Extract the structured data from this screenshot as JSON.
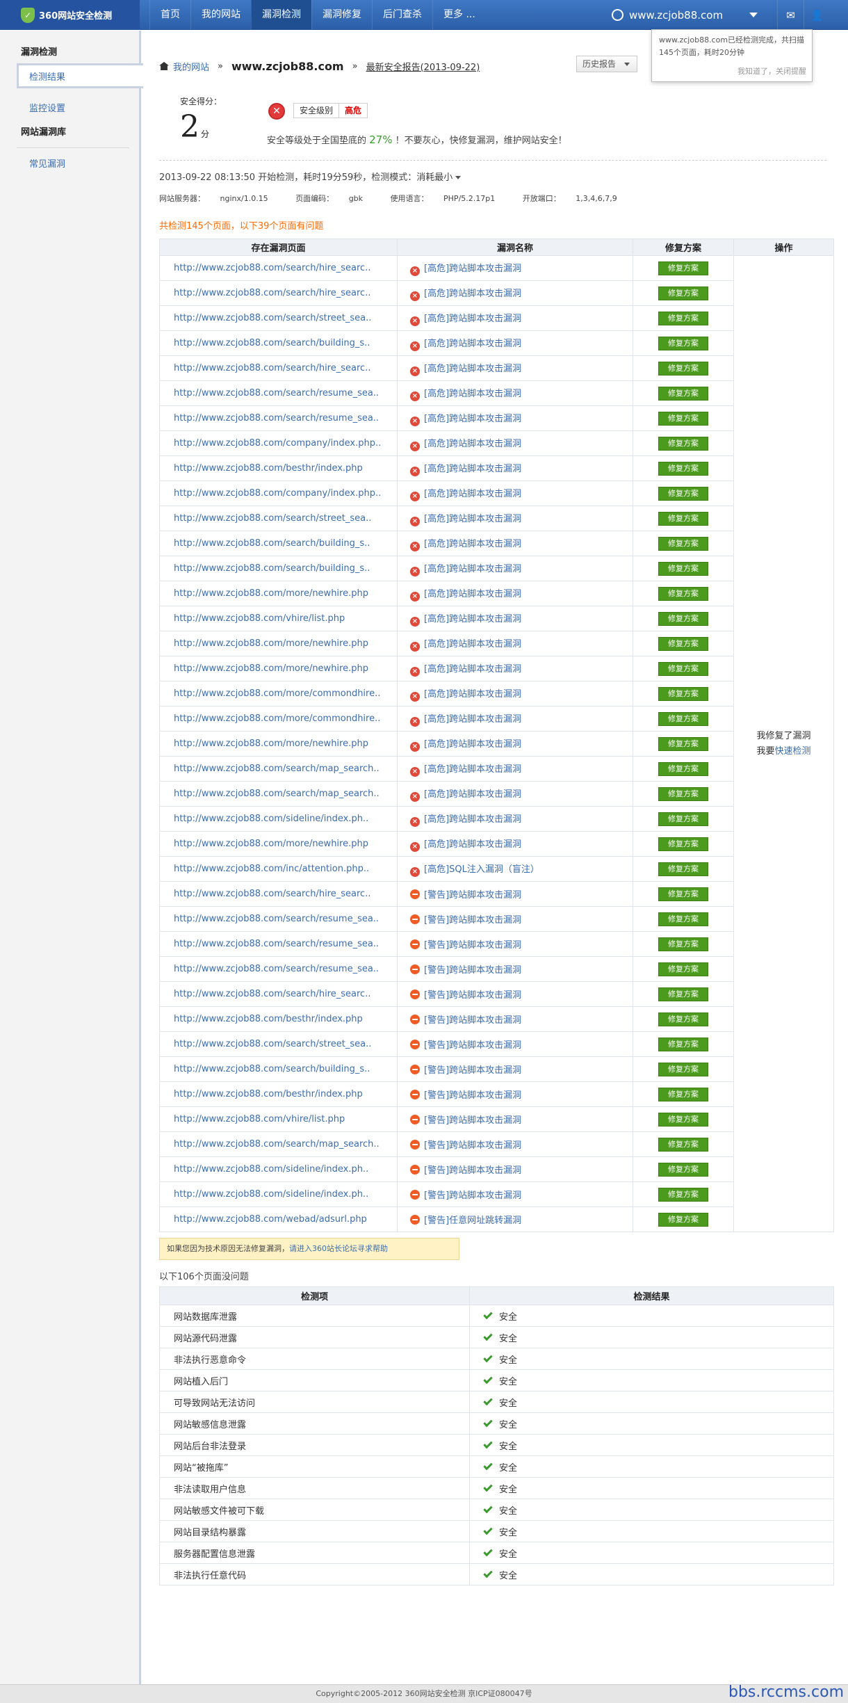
{
  "header": {
    "logo_text": "360网站安全检测",
    "nav": [
      "首页",
      "我的网站",
      "漏洞检测",
      "漏洞修复",
      "后门查杀",
      "更多 ..."
    ],
    "active_nav": 2,
    "site_domain": "www.zcjob88.com",
    "mail_icon": "mail-icon",
    "user_icon": "user-icon"
  },
  "popup": {
    "message": "www.zcjob88.com已经检测完成，共扫描145个页面，耗时20分钟",
    "dismiss": "我知道了，关闭提醒"
  },
  "sidebar": {
    "section1": "漏洞检测",
    "items1": [
      "检测结果",
      "监控设置"
    ],
    "section2": "网站漏洞库",
    "items2": [
      "常见漏洞"
    ]
  },
  "breadcrumb": {
    "home": "我的网站",
    "domain": "www.zcjob88.com",
    "latest_report": "最新安全报告(2013-09-22)",
    "history_button": "历史报告"
  },
  "score": {
    "label": "安全得分：",
    "value": "2",
    "unit": "分",
    "level_label": "安全级别",
    "level_value": "高危",
    "ad_prefix": "安全等级处于全国垫底的",
    "ad_percent": "27%",
    "ad_suffix": "！不要灰心，快修复漏洞，维护网站安全！"
  },
  "scan": {
    "timeline": "2013-09-22 08:13:50 开始检测，耗时19分59秒，检测模式：消耗最小",
    "server_label": "网站服务器：",
    "server": "nginx/1.0.15",
    "encoding_label": "页面编码：",
    "encoding": "gbk",
    "language_label": "使用语言：",
    "language": "PHP/5.2.17p1",
    "ports_label": "开放端口：",
    "ports": "1,3,4,6,7,9",
    "summary": "共检测145个页面，以下39个页面有问题"
  },
  "vuln_table": {
    "headers": [
      "存在漏洞页面",
      "漏洞名称",
      "修复方案",
      "操作"
    ],
    "fix_label": "修复方案",
    "op_line1": "我修复了漏洞",
    "op_line2_prefix": "我要",
    "op_line2_link": "快速检测",
    "rows": [
      {
        "url": "http://www.zcjob88.com/search/hire_searc..",
        "severity": "high",
        "name": "[高危]跨站脚本攻击漏洞"
      },
      {
        "url": "http://www.zcjob88.com/search/hire_searc..",
        "severity": "high",
        "name": "[高危]跨站脚本攻击漏洞"
      },
      {
        "url": "http://www.zcjob88.com/search/street_sea..",
        "severity": "high",
        "name": "[高危]跨站脚本攻击漏洞"
      },
      {
        "url": "http://www.zcjob88.com/search/building_s..",
        "severity": "high",
        "name": "[高危]跨站脚本攻击漏洞"
      },
      {
        "url": "http://www.zcjob88.com/search/hire_searc..",
        "severity": "high",
        "name": "[高危]跨站脚本攻击漏洞"
      },
      {
        "url": "http://www.zcjob88.com/search/resume_sea..",
        "severity": "high",
        "name": "[高危]跨站脚本攻击漏洞"
      },
      {
        "url": "http://www.zcjob88.com/search/resume_sea..",
        "severity": "high",
        "name": "[高危]跨站脚本攻击漏洞"
      },
      {
        "url": "http://www.zcjob88.com/company/index.php..",
        "severity": "high",
        "name": "[高危]跨站脚本攻击漏洞"
      },
      {
        "url": "http://www.zcjob88.com/besthr/index.php",
        "severity": "high",
        "name": "[高危]跨站脚本攻击漏洞"
      },
      {
        "url": "http://www.zcjob88.com/company/index.php..",
        "severity": "high",
        "name": "[高危]跨站脚本攻击漏洞"
      },
      {
        "url": "http://www.zcjob88.com/search/street_sea..",
        "severity": "high",
        "name": "[高危]跨站脚本攻击漏洞"
      },
      {
        "url": "http://www.zcjob88.com/search/building_s..",
        "severity": "high",
        "name": "[高危]跨站脚本攻击漏洞"
      },
      {
        "url": "http://www.zcjob88.com/search/building_s..",
        "severity": "high",
        "name": "[高危]跨站脚本攻击漏洞"
      },
      {
        "url": "http://www.zcjob88.com/more/newhire.php",
        "severity": "high",
        "name": "[高危]跨站脚本攻击漏洞"
      },
      {
        "url": "http://www.zcjob88.com/vhire/list.php",
        "severity": "high",
        "name": "[高危]跨站脚本攻击漏洞"
      },
      {
        "url": "http://www.zcjob88.com/more/newhire.php",
        "severity": "high",
        "name": "[高危]跨站脚本攻击漏洞"
      },
      {
        "url": "http://www.zcjob88.com/more/newhire.php",
        "severity": "high",
        "name": "[高危]跨站脚本攻击漏洞"
      },
      {
        "url": "http://www.zcjob88.com/more/commondhire..",
        "severity": "high",
        "name": "[高危]跨站脚本攻击漏洞"
      },
      {
        "url": "http://www.zcjob88.com/more/commondhire..",
        "severity": "high",
        "name": "[高危]跨站脚本攻击漏洞"
      },
      {
        "url": "http://www.zcjob88.com/more/newhire.php",
        "severity": "high",
        "name": "[高危]跨站脚本攻击漏洞"
      },
      {
        "url": "http://www.zcjob88.com/search/map_search..",
        "severity": "high",
        "name": "[高危]跨站脚本攻击漏洞"
      },
      {
        "url": "http://www.zcjob88.com/search/map_search..",
        "severity": "high",
        "name": "[高危]跨站脚本攻击漏洞"
      },
      {
        "url": "http://www.zcjob88.com/sideline/index.ph..",
        "severity": "high",
        "name": "[高危]跨站脚本攻击漏洞"
      },
      {
        "url": "http://www.zcjob88.com/more/newhire.php",
        "severity": "high",
        "name": "[高危]跨站脚本攻击漏洞"
      },
      {
        "url": "http://www.zcjob88.com/inc/attention.php..",
        "severity": "high",
        "name": "[高危]SQL注入漏洞（盲注）"
      },
      {
        "url": "http://www.zcjob88.com/search/hire_searc..",
        "severity": "warn",
        "name": "[警告]跨站脚本攻击漏洞"
      },
      {
        "url": "http://www.zcjob88.com/search/resume_sea..",
        "severity": "warn",
        "name": "[警告]跨站脚本攻击漏洞"
      },
      {
        "url": "http://www.zcjob88.com/search/resume_sea..",
        "severity": "warn",
        "name": "[警告]跨站脚本攻击漏洞"
      },
      {
        "url": "http://www.zcjob88.com/search/resume_sea..",
        "severity": "warn",
        "name": "[警告]跨站脚本攻击漏洞"
      },
      {
        "url": "http://www.zcjob88.com/search/hire_searc..",
        "severity": "warn",
        "name": "[警告]跨站脚本攻击漏洞"
      },
      {
        "url": "http://www.zcjob88.com/besthr/index.php",
        "severity": "warn",
        "name": "[警告]跨站脚本攻击漏洞"
      },
      {
        "url": "http://www.zcjob88.com/search/street_sea..",
        "severity": "warn",
        "name": "[警告]跨站脚本攻击漏洞"
      },
      {
        "url": "http://www.zcjob88.com/search/building_s..",
        "severity": "warn",
        "name": "[警告]跨站脚本攻击漏洞"
      },
      {
        "url": "http://www.zcjob88.com/besthr/index.php",
        "severity": "warn",
        "name": "[警告]跨站脚本攻击漏洞"
      },
      {
        "url": "http://www.zcjob88.com/vhire/list.php",
        "severity": "warn",
        "name": "[警告]跨站脚本攻击漏洞"
      },
      {
        "url": "http://www.zcjob88.com/search/map_search..",
        "severity": "warn",
        "name": "[警告]跨站脚本攻击漏洞"
      },
      {
        "url": "http://www.zcjob88.com/sideline/index.ph..",
        "severity": "warn",
        "name": "[警告]跨站脚本攻击漏洞"
      },
      {
        "url": "http://www.zcjob88.com/sideline/index.ph..",
        "severity": "warn",
        "name": "[警告]跨站脚本攻击漏洞"
      },
      {
        "url": "http://www.zcjob88.com/webad/adsurl.php",
        "severity": "warn",
        "name": "[警告]任意网址跳转漏洞"
      }
    ]
  },
  "notice": {
    "text": "如果您因为技术原因无法修复漏洞，",
    "link": "请进入360站长论坛寻求帮助"
  },
  "safe_table": {
    "summary": "以下106个页面没问题",
    "headers": [
      "检测项",
      "检测结果"
    ],
    "result_label": "安全",
    "items": [
      "网站数据库泄露",
      "网站源代码泄露",
      "非法执行恶意命令",
      "网站植入后门",
      "可导致网站无法访问",
      "网站敏感信息泄露",
      "网站后台非法登录",
      "网站“被拖库”",
      "非法读取用户信息",
      "网站敏感文件被可下载",
      "网站目录结构暴露",
      "服务器配置信息泄露",
      "非法执行任意代码"
    ]
  },
  "footer": {
    "text": "Copyright©2005-2012 360网站安全检测 京ICP证080047号",
    "watermark": "bbs.rccms.com"
  },
  "colors": {
    "nav_blue": "#2c5fa8",
    "high": "#e04a3a",
    "warn": "#f05a24",
    "fix_green": "#4c9b1f",
    "link": "#3a6cb0",
    "count_orange": "#ff6a00"
  }
}
